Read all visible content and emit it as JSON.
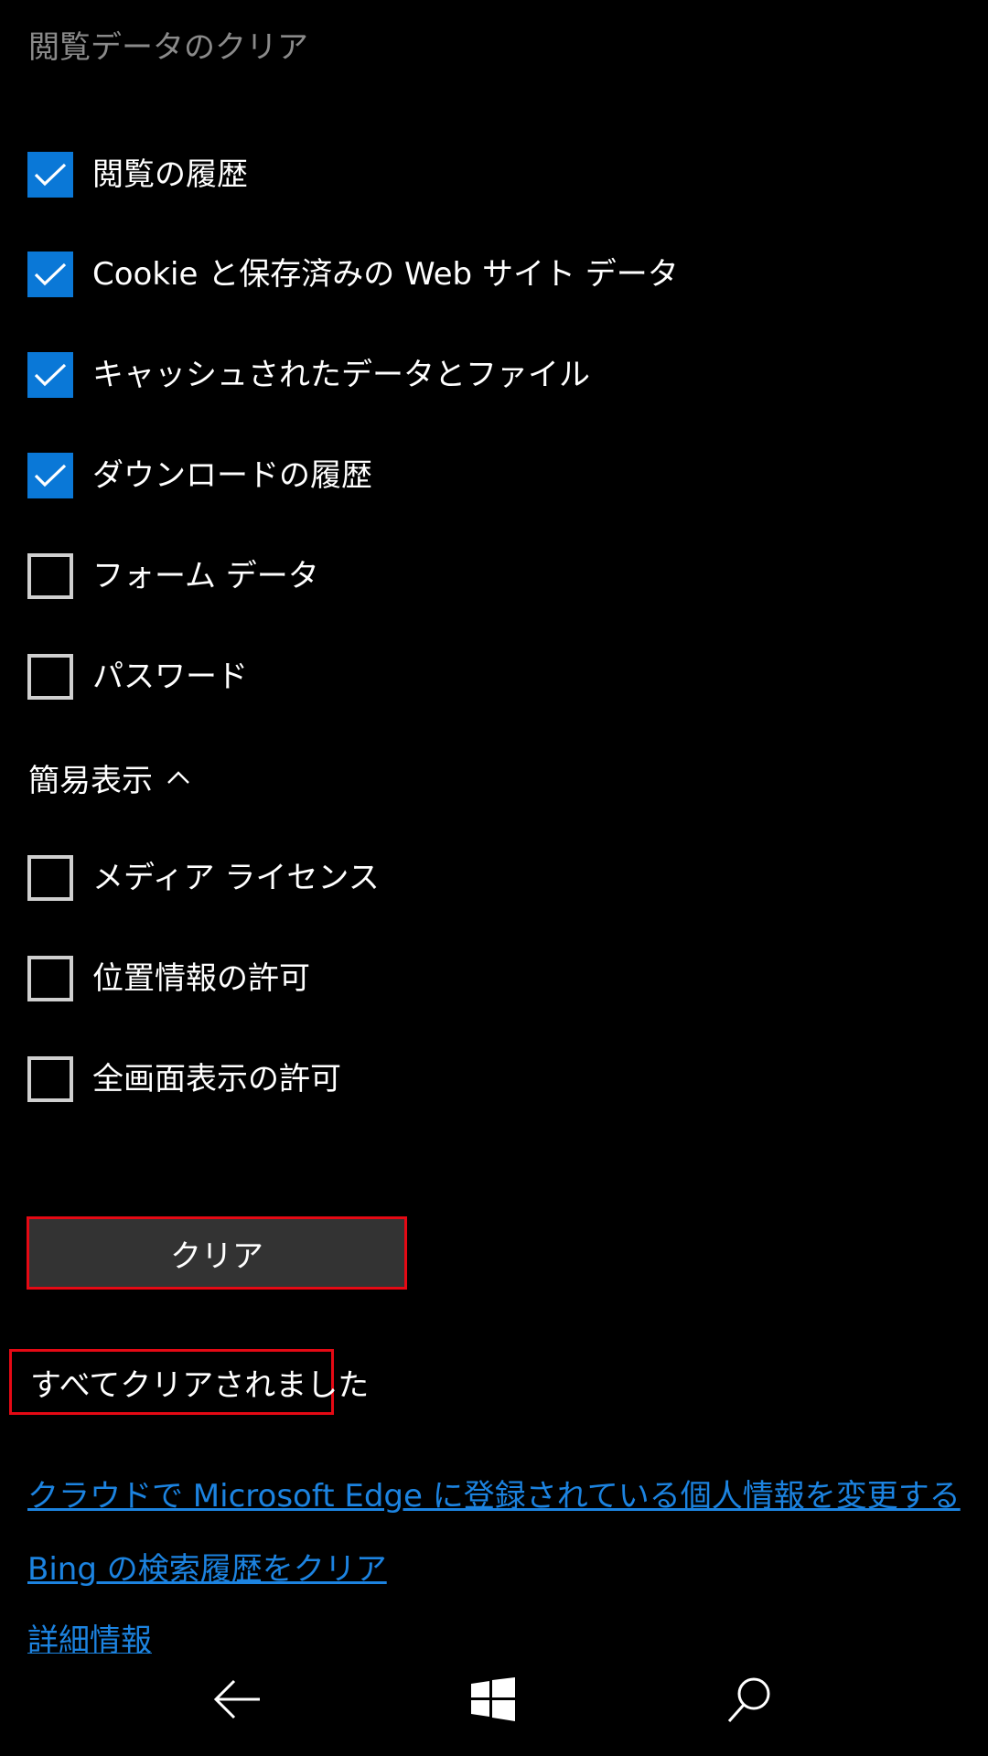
{
  "page": {
    "title": "閲覧データのクリア"
  },
  "options": [
    {
      "label": "閲覧の履歴",
      "checked": true
    },
    {
      "label": "Cookie と保存済みの Web サイト データ",
      "checked": true
    },
    {
      "label": "キャッシュされたデータとファイル",
      "checked": true
    },
    {
      "label": "ダウンロードの履歴",
      "checked": true
    },
    {
      "label": "フォーム データ",
      "checked": false
    },
    {
      "label": "パスワード",
      "checked": false
    }
  ],
  "collapse_toggle": {
    "label": "簡易表示",
    "icon": "chevron-up-icon"
  },
  "advanced_options": [
    {
      "label": "メディア ライセンス",
      "checked": false
    },
    {
      "label": "位置情報の許可",
      "checked": false
    },
    {
      "label": "全画面表示の許可",
      "checked": false
    }
  ],
  "clear_button": {
    "label": "クリア"
  },
  "status": {
    "text": "すべてクリアされました"
  },
  "links": {
    "cloud": "クラウドで Microsoft Edge に登録されている個人情報を変更する",
    "bing": "Bing の検索履歴をクリア",
    "details": "詳細情報"
  },
  "nav": {
    "back_icon": "back-arrow-icon",
    "home_icon": "windows-logo-icon",
    "search_icon": "search-icon"
  },
  "colors": {
    "accent": "#0a78d7",
    "link": "#1c83e0",
    "highlight": "#e50914",
    "button_bg": "#333333",
    "background": "#000000"
  }
}
